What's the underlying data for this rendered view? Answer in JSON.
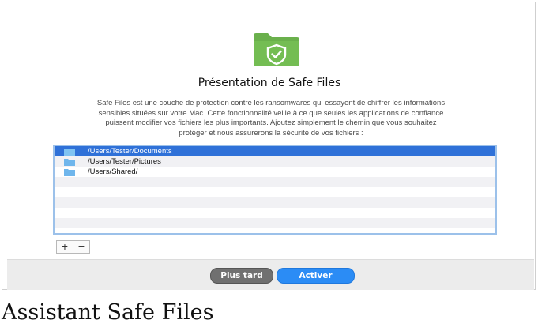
{
  "dialog": {
    "title": "Présentation de Safe Files",
    "description_lines": [
      "Safe Files est une couche de protection contre les ransomwares qui essayent de chiffrer les informations",
      "sensibles situées sur votre Mac. Cette fonctionnalité veille à ce que seules les applications de confiance",
      "puissent modifier vos fichiers les plus importants. Ajoutez simplement le chemin que vous souhaitez",
      "protéger et nous assurerons la sécurité de vos fichiers :"
    ],
    "paths": [
      {
        "label": "/Users/Tester/Documents",
        "icon": "folder-icon",
        "selected": true
      },
      {
        "label": "/Users/Tester/Pictures",
        "icon": "folder-icon",
        "selected": false
      },
      {
        "label": "/Users/Shared/",
        "icon": "folder-icon",
        "selected": false
      }
    ],
    "add_label": "+",
    "remove_label": "−",
    "later_label": "Plus tard",
    "activate_label": "Activer"
  },
  "caption": "Assistant Safe Files",
  "colors": {
    "icon_green": "#6ab04c",
    "selection_blue": "#2f71d8",
    "activate_blue": "#2b8cf5",
    "later_gray": "#707070"
  }
}
